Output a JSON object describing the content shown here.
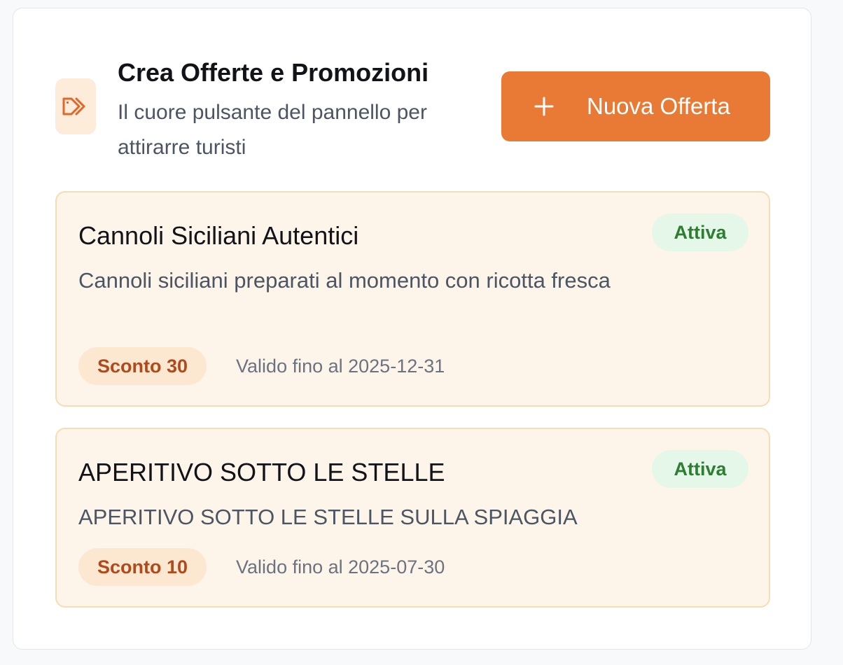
{
  "header": {
    "icon": "tag-icon",
    "title": "Crea Offerte e Promozioni",
    "subtitle": "Il cuore pulsante del pannello per attirarre turisti",
    "new_offer_label": "Nuova Offerta",
    "new_offer_icon": "plus-icon"
  },
  "colors": {
    "accent": "#e97a36",
    "card_background": "#fdf5ea",
    "card_border": "#f5ddb4",
    "status_green": "#2e7d32",
    "discount_text": "#b14a1b"
  },
  "offers": [
    {
      "title": "Cannoli Siciliani Autentici",
      "status": "Attiva",
      "description": "Cannoli siciliani preparati al momento con ricotta fresca",
      "discount": "Sconto 30",
      "validity": "Valido fino al 2025-12-31"
    },
    {
      "title": "APERITIVO SOTTO LE STELLE",
      "status": "Attiva",
      "description": "APERITIVO SOTTO LE STELLE SULLA SPIAGGIA",
      "discount": "Sconto 10",
      "validity": "Valido fino al 2025-07-30"
    }
  ]
}
